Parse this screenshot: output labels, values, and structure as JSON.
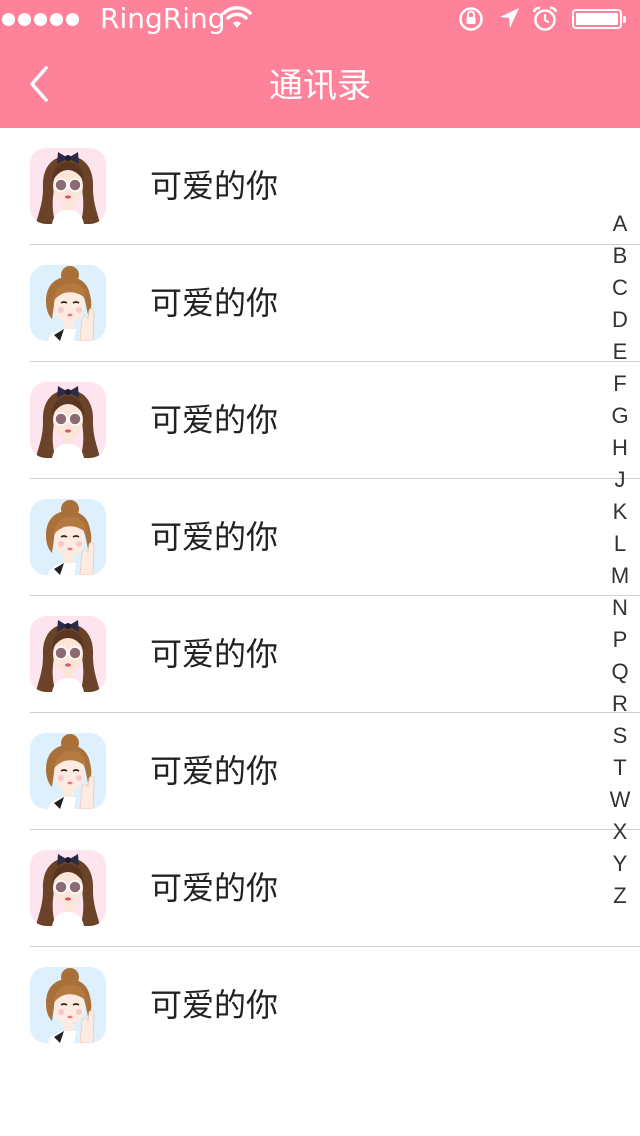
{
  "status_bar": {
    "carrier": "RingRing",
    "signal_dots": 5
  },
  "nav": {
    "title": "通讯录",
    "back_icon": "chevron-left-icon"
  },
  "colors": {
    "header": "#fe8299",
    "separator": "#cfcfcf",
    "text": "#222222"
  },
  "contacts": [
    {
      "name": "可爱的你",
      "avatar": "girl-sunglasses-bow-avatar"
    },
    {
      "name": "可爱的你",
      "avatar": "girl-bun-hand-avatar"
    },
    {
      "name": "可爱的你",
      "avatar": "girl-sunglasses-bow-avatar"
    },
    {
      "name": "可爱的你",
      "avatar": "girl-bun-hand-avatar"
    },
    {
      "name": "可爱的你",
      "avatar": "girl-sunglasses-bow-avatar"
    },
    {
      "name": "可爱的你",
      "avatar": "girl-bun-hand-avatar"
    },
    {
      "name": "可爱的你",
      "avatar": "girl-sunglasses-bow-avatar"
    },
    {
      "name": "可爱的你",
      "avatar": "girl-bun-hand-avatar"
    }
  ],
  "alphabet": [
    "A",
    "B",
    "C",
    "D",
    "E",
    "F",
    "G",
    "H",
    "J",
    "K",
    "L",
    "M",
    "N",
    "P",
    "Q",
    "R",
    "S",
    "T",
    "W",
    "X",
    "Y",
    "Z"
  ]
}
